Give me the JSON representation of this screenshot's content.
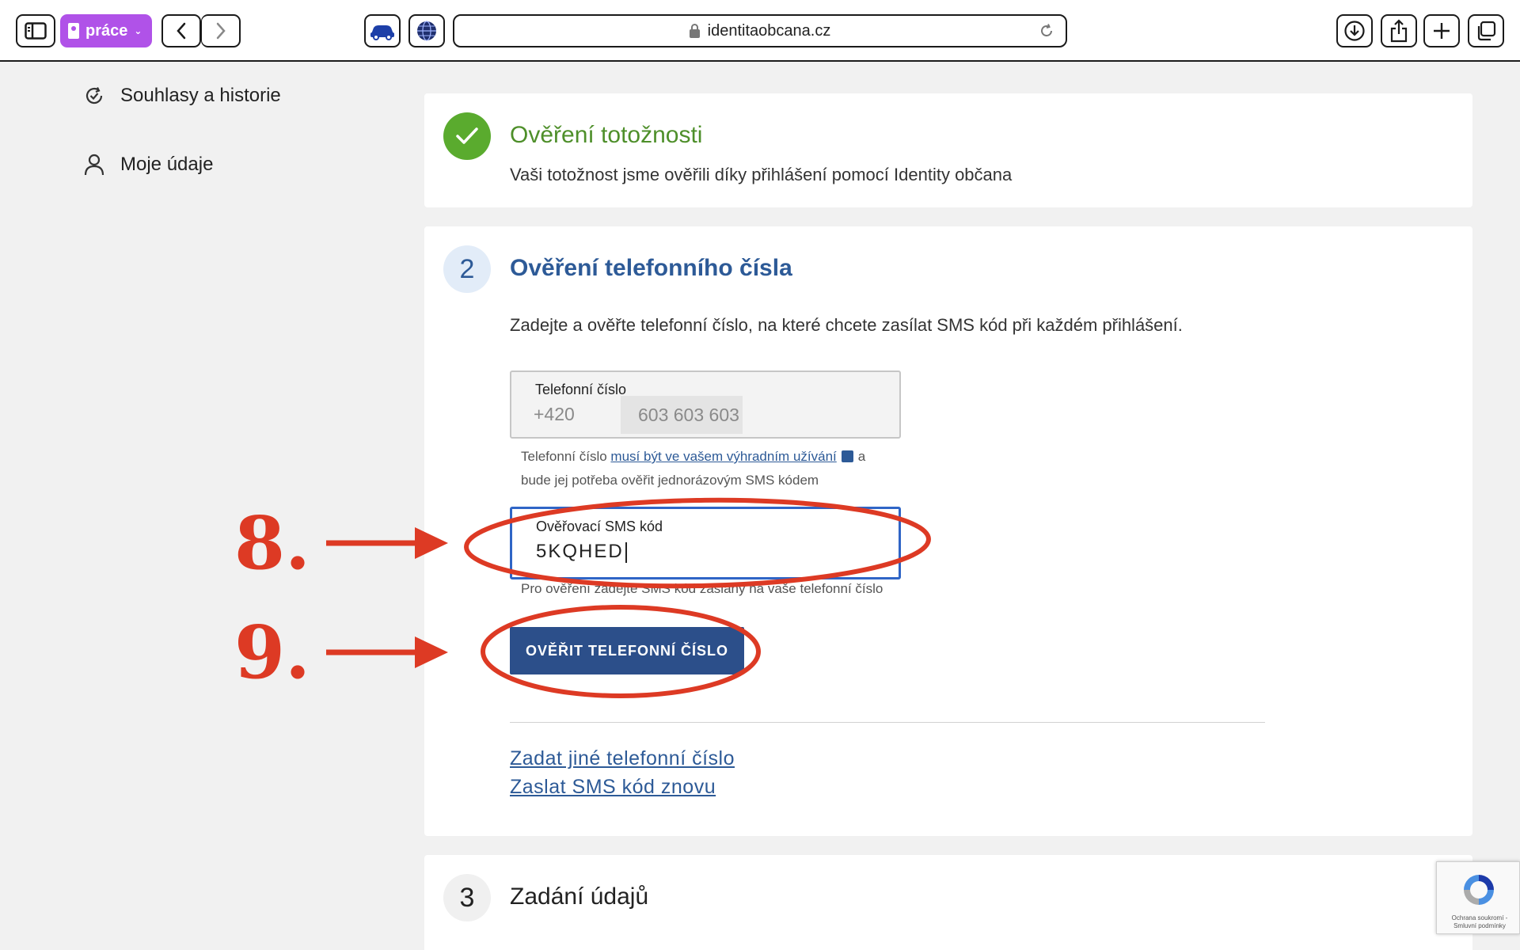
{
  "browser": {
    "profile_label": "práce",
    "url": "identitaobcana.cz"
  },
  "sidebar": {
    "items": [
      {
        "label": "Souhlasy a historie",
        "icon": "refresh-check-icon"
      },
      {
        "label": "Moje údaje",
        "icon": "user-icon"
      }
    ]
  },
  "step1": {
    "title": "Ověření totožnosti",
    "subtitle": "Vaši totožnost jsme ověřili díky přihlášení pomocí Identity občana",
    "status": "done"
  },
  "step2": {
    "number": "2",
    "title": "Ověření telefonního čísla",
    "intro": "Zadejte a ověřte telefonní číslo, na které chcete zasílat SMS kód při každém přihlášení.",
    "phone_field": {
      "label": "Telefonní číslo",
      "prefix": "+420",
      "value": "603 603 603"
    },
    "phone_help": {
      "before": "Telefonní číslo",
      "link": "musí být ve vašem výhradním užívání",
      "after_link": "a",
      "line2": "bude jej potřeba ověřit jednorázovým SMS kódem"
    },
    "sms_field": {
      "label": "Ověřovací SMS kód",
      "value": "5KQHED",
      "help": "Pro ověření zadejte SMS kód zaslaný na vaše telefonní číslo"
    },
    "verify_button": "OVĚŘIT TELEFONNÍ ČÍSLO",
    "links": {
      "other_number": "Zadat jiné telefonní číslo",
      "resend": "Zaslat SMS kód znovu"
    }
  },
  "step3": {
    "number": "3",
    "title": "Zadání údajů"
  },
  "annotations": {
    "marker_8": "8.",
    "marker_9": "9.",
    "color": "#dd3a24"
  },
  "recaptcha": {
    "text": "Ochrana soukromí - Smluvní podmínky"
  },
  "colors": {
    "accent_blue": "#2d5a97",
    "success_green": "#5aab2e",
    "button_bg": "#2c4f8a",
    "profile_purple": "#b052e8"
  }
}
